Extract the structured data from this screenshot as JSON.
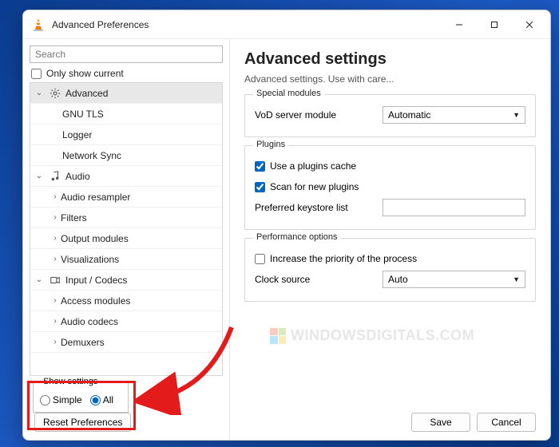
{
  "window": {
    "title": "Advanced Preferences"
  },
  "left": {
    "search_placeholder": "Search",
    "only_show_current": "Only show current",
    "tree": {
      "advanced": "Advanced",
      "gnu_tls": "GNU TLS",
      "logger": "Logger",
      "network_sync": "Network Sync",
      "audio": "Audio",
      "audio_resampler": "Audio resampler",
      "filters": "Filters",
      "output_modules": "Output modules",
      "visualizations": "Visualizations",
      "input_codecs": "Input / Codecs",
      "access_modules": "Access modules",
      "audio_codecs": "Audio codecs",
      "demuxers": "Demuxers"
    },
    "show_settings": {
      "group_label": "Show settings",
      "simple": "Simple",
      "all": "All"
    },
    "reset_button": "Reset Preferences"
  },
  "right": {
    "heading": "Advanced settings",
    "description": "Advanced settings. Use with care...",
    "special_modules": {
      "group_label": "Special modules",
      "vod_label": "VoD server module",
      "vod_value": "Automatic"
    },
    "plugins": {
      "group_label": "Plugins",
      "cache": "Use a plugins cache",
      "scan": "Scan for new plugins",
      "keystore_label": "Preferred keystore list"
    },
    "performance": {
      "group_label": "Performance options",
      "priority": "Increase the priority of the process",
      "clock_label": "Clock source",
      "clock_value": "Auto"
    },
    "save": "Save",
    "cancel": "Cancel"
  },
  "watermark": "WINDOWSDIGITALS.COM"
}
